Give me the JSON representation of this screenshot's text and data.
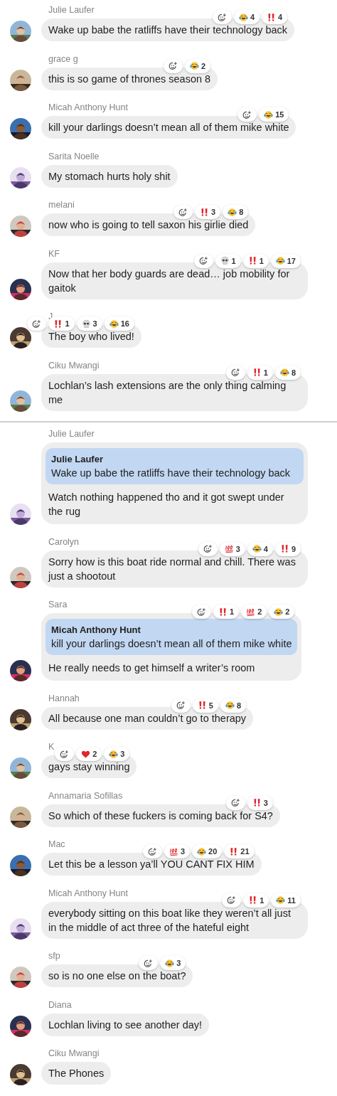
{
  "sections": [
    {
      "messages": [
        {
          "author": "Julie Laufer",
          "text": "Wake up babe the ratliffs have their technology back",
          "reactions": [
            {
              "kind": "laugh",
              "count": "4"
            },
            {
              "kind": "bang",
              "count": "4"
            }
          ]
        },
        {
          "author": "grace g",
          "text": "this is so game of thrones season 8",
          "reactions": [
            {
              "kind": "laugh",
              "count": "2"
            }
          ]
        },
        {
          "author": "Micah Anthony Hunt",
          "text": "kill your darlings doesn’t mean all of them mike white",
          "reactions": [
            {
              "kind": "laugh",
              "count": "15"
            }
          ]
        },
        {
          "author": "Sarita Noelle",
          "text": "My stomach hurts holy shit"
        },
        {
          "author": "melani",
          "text": "now who is going to tell saxon his girlie died",
          "reactions": [
            {
              "kind": "bang",
              "count": "3"
            },
            {
              "kind": "laugh",
              "count": "8"
            }
          ]
        },
        {
          "author": "KF",
          "text": "Now that her body guards are dead… job mobility for gaitok",
          "reactions": [
            {
              "kind": "skull",
              "count": "1"
            },
            {
              "kind": "bang",
              "count": "1"
            },
            {
              "kind": "laugh",
              "count": "17"
            }
          ]
        },
        {
          "author": "J",
          "text": "The boy who lived!",
          "reactions": [
            {
              "kind": "bang",
              "count": "1"
            },
            {
              "kind": "skull",
              "count": "3"
            },
            {
              "kind": "laugh",
              "count": "16"
            }
          ]
        },
        {
          "author": "Ciku Mwangi",
          "text": "Lochlan’s lash extensions are the only thing calming me",
          "reactions": [
            {
              "kind": "bang",
              "count": "1"
            },
            {
              "kind": "laugh",
              "count": "8"
            }
          ]
        }
      ]
    },
    {
      "messages": [
        {
          "author": "Julie Laufer",
          "quote": {
            "author": "Julie Laufer",
            "text": "Wake up babe the ratliffs have their technology back"
          },
          "text": "Watch nothing happened tho and it got swept under the rug"
        },
        {
          "author": "Carolyn",
          "text": "Sorry how is this boat ride normal and chill. There was just a shootout",
          "reactions": [
            {
              "kind": "hundred",
              "count": "3"
            },
            {
              "kind": "laugh",
              "count": "4"
            },
            {
              "kind": "bang",
              "count": "9"
            }
          ]
        },
        {
          "author": "Sara",
          "quote": {
            "author": "Micah Anthony Hunt",
            "text": "kill your darlings doesn’t mean all of them mike white"
          },
          "text": "He really needs to get himself a writer’s room",
          "reactions": [
            {
              "kind": "bang",
              "count": "1"
            },
            {
              "kind": "hundred",
              "count": "2"
            },
            {
              "kind": "laugh",
              "count": "2"
            }
          ]
        },
        {
          "author": "Hannah",
          "text": "All because one man couldn’t go to therapy",
          "reactions": [
            {
              "kind": "bang",
              "count": "5"
            },
            {
              "kind": "laugh",
              "count": "8"
            }
          ]
        },
        {
          "author": "K",
          "text": "gays stay winning",
          "reactions": [
            {
              "kind": "heart",
              "count": "2"
            },
            {
              "kind": "laugh",
              "count": "3"
            }
          ]
        },
        {
          "author": "Annamaria Sofillas",
          "text": "So which of these fuckers is coming back for S4?",
          "reactions": [
            {
              "kind": "bang",
              "count": "3"
            }
          ]
        },
        {
          "author": "Mac",
          "text": "Let this be a lesson ya’ll YOU CANT FIX HIM",
          "reactions": [
            {
              "kind": "hundred",
              "count": "3"
            },
            {
              "kind": "laugh",
              "count": "20"
            },
            {
              "kind": "bang",
              "count": "21"
            }
          ]
        },
        {
          "author": "Micah Anthony Hunt",
          "text": "everybody sitting on this boat like they weren’t all just in the middle of act three of the hateful eight",
          "reactions": [
            {
              "kind": "bang",
              "count": "1"
            },
            {
              "kind": "laugh",
              "count": "11"
            }
          ]
        },
        {
          "author": "sfp",
          "text": "so is no one else on the boat?",
          "reactions": [
            {
              "kind": "laugh",
              "count": "3"
            }
          ]
        },
        {
          "author": "Diana",
          "text": "Lochlan living to see another day!"
        },
        {
          "author": "Ciku Mwangi",
          "text": "The Phones"
        }
      ]
    }
  ]
}
